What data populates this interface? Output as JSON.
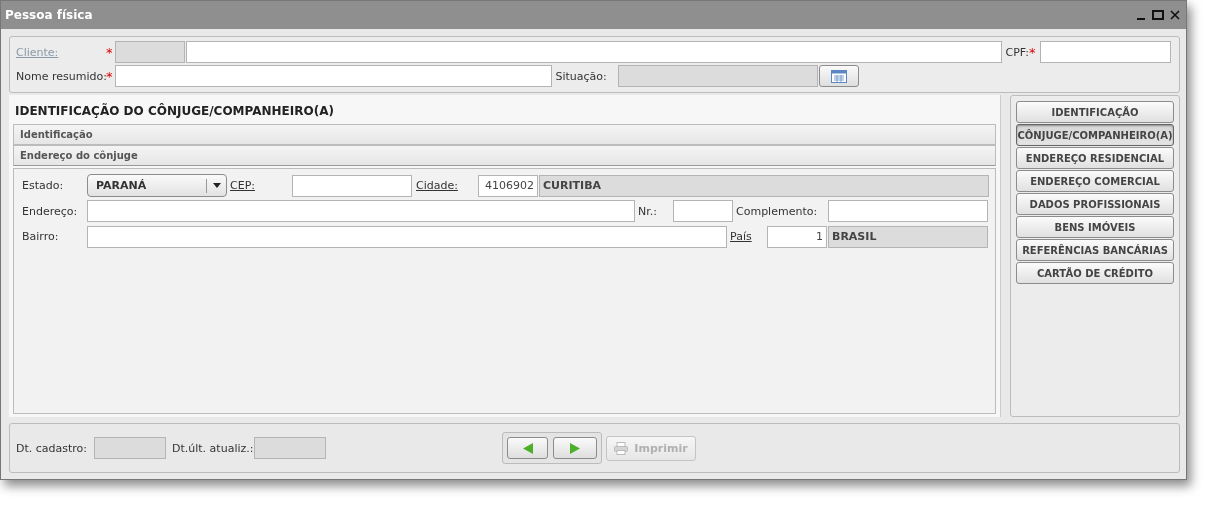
{
  "window": {
    "title": "Pessoa física"
  },
  "header": {
    "cliente": {
      "label": "Cliente:",
      "required_mark": "*",
      "code_disabled": true
    },
    "cpf": {
      "label": "CPF:",
      "required_mark": "*"
    },
    "nome_resumido": {
      "label": "Nome resumido:",
      "required_mark": "*"
    },
    "situacao": {
      "label": "Situação:",
      "disabled": true
    }
  },
  "section": {
    "title": "IDENTIFICAÇÃO DO CÔNJUGE/COMPANHEIRO(A)",
    "groups": [
      {
        "label": "Identificação",
        "expanded": false
      },
      {
        "label": "Endereço do cônjuge",
        "expanded": true
      }
    ],
    "estado": {
      "label": "Estado:",
      "value": "PARANÁ"
    },
    "cep": {
      "label": "CEP:"
    },
    "cidade": {
      "label": "Cidade:",
      "code": "4106902",
      "name": "CURITIBA"
    },
    "endereco": {
      "label": "Endereço:"
    },
    "nr": {
      "label": "Nr.:"
    },
    "complemento": {
      "label": "Complemento:"
    },
    "bairro": {
      "label": "Bairro:"
    },
    "pais": {
      "label": "País",
      "code": "1",
      "name": "BRASIL"
    }
  },
  "side_menu": [
    {
      "label": "IDENTIFICAÇÃO",
      "selected": false
    },
    {
      "label": "CÔNJUGE/COMPANHEIRO(A)",
      "selected": true
    },
    {
      "label": "ENDEREÇO RESIDENCIAL",
      "selected": false
    },
    {
      "label": "ENDEREÇO COMERCIAL",
      "selected": false
    },
    {
      "label": "DADOS PROFISSIONAIS",
      "selected": false
    },
    {
      "label": "BENS IMÓVEIS",
      "selected": false
    },
    {
      "label": "REFERÊNCIAS BANCÁRIAS",
      "selected": false
    },
    {
      "label": "CARTÃO DE CRÉDITO",
      "selected": false
    }
  ],
  "footer": {
    "dt_cadastro": {
      "label": "Dt. cadastro:"
    },
    "dt_atualiz": {
      "label": "Dt.últ. atualiz.:"
    },
    "print": {
      "label": "Imprimir",
      "disabled": true
    }
  }
}
